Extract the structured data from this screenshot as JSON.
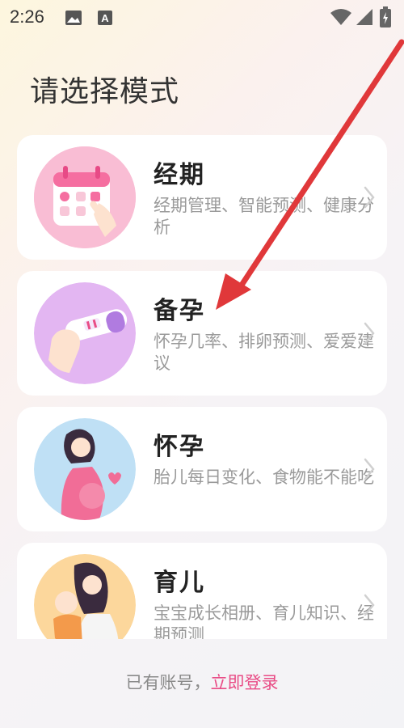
{
  "status": {
    "time": "2:26",
    "icons": [
      "image-icon",
      "font-a-icon",
      "wifi-icon",
      "signal-icon",
      "battery-icon"
    ]
  },
  "title": "请选择模式",
  "modes": [
    {
      "title": "经期",
      "desc": "经期管理、智能预测、健康分析",
      "icon": "calendar-hand-icon"
    },
    {
      "title": "备孕",
      "desc": "怀孕几率、排卵预测、爱爱建议",
      "icon": "pregnancy-test-icon"
    },
    {
      "title": "怀孕",
      "desc": "胎儿每日变化、食物能不能吃",
      "icon": "pregnant-woman-icon"
    },
    {
      "title": "育儿",
      "desc": "宝宝成长相册、育儿知识、经期预测",
      "icon": "mother-baby-icon"
    }
  ],
  "login": {
    "prefix": "已有账号，",
    "link": "立即登录"
  },
  "colors": {
    "accent": "#e94c86",
    "arrow": "#e0383a"
  }
}
